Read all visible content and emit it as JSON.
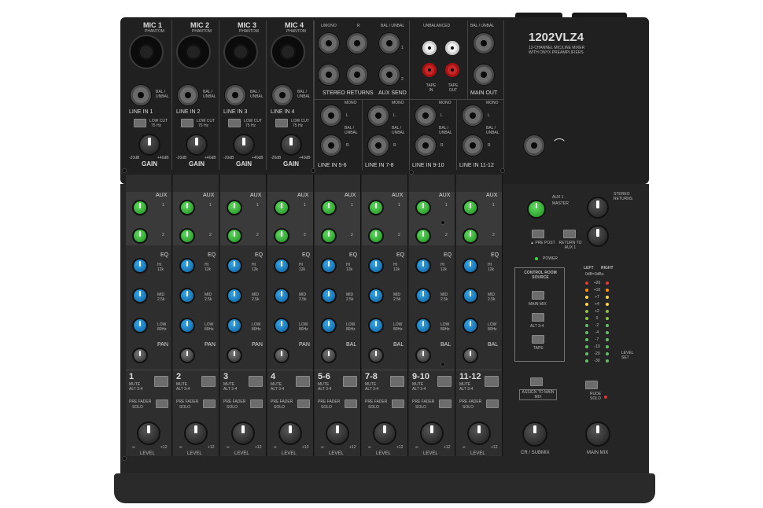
{
  "model": {
    "name": "1202VLZ4",
    "tagline_1": "12-CHANNEL MIC/LINE MIXER",
    "tagline_2": "WITH ONYX PREAMPLIFIERS"
  },
  "mic_channels": [
    {
      "mic_label": "MIC 1",
      "line_label": "LINE IN 1"
    },
    {
      "mic_label": "MIC 2",
      "line_label": "LINE IN 2"
    },
    {
      "mic_label": "MIC 3",
      "line_label": "LINE IN 3"
    },
    {
      "mic_label": "MIC 4",
      "line_label": "LINE IN 4"
    }
  ],
  "mic_small": "PHANTOM",
  "bal_unbal": "BAL / UNBAL",
  "low_cut": "LOW CUT",
  "low_cut_freq": "75 Hz",
  "gain": "GAIN",
  "gain_range": {
    "min": "-20dB",
    "max": "+40dB"
  },
  "top_right": {
    "l_mono": "L/MONO",
    "r": "R",
    "stereo_returns": "STEREO RETURNS",
    "bal_unbal": "BAL / UNBAL",
    "aux_send": "AUX SEND",
    "unbalanced": "UNBALANCED",
    "tape_in": "TAPE IN",
    "tape_out": "TAPE OUT",
    "main_out": "MAIN OUT",
    "mono": "MONO",
    "line_in_labels": [
      "LINE IN 5-6",
      "LINE IN 7-8",
      "LINE IN 9-10",
      "LINE IN 11-12"
    ],
    "num_1": "1",
    "num_2": "2",
    "l": "L"
  },
  "strip_labels": {
    "aux": "AUX",
    "aux_1": "1",
    "aux_2": "2",
    "eq": "EQ",
    "hi": "HI",
    "hi_freq": "12k",
    "mid": "MID",
    "mid_freq": "2.5k",
    "low": "LOW",
    "low_freq": "80Hz",
    "pan": "PAN",
    "bal": "BAL",
    "mute": "MUTE",
    "alt": "ALT 3-4",
    "pre_fader": "PRE FADER",
    "solo": "SOLO",
    "level": "LEVEL",
    "inf": "∞",
    "plus12": "+12"
  },
  "strips": [
    {
      "number": "1"
    },
    {
      "number": "2"
    },
    {
      "number": "3"
    },
    {
      "number": "4"
    },
    {
      "number": "5-6"
    },
    {
      "number": "7-8"
    },
    {
      "number": "9-10"
    },
    {
      "number": "11-12"
    }
  ],
  "master": {
    "aux1_master": "AUX 1",
    "master": "MASTER",
    "stereo_returns": "STEREO RETURNS",
    "pre_post": "▲ PRE POST",
    "return_to": "RETURN TO AUX 1",
    "power": "POWER",
    "control_room": "CONTROL ROOM SOURCE",
    "main_mix_btn": "MAIN MIX",
    "alt_btn": "ALT 3-4",
    "tape_btn": "TAPE",
    "assign": "ASSIGN TO MAIN MIX",
    "left": "LEFT",
    "right": "RIGHT",
    "dbu": "0dB=0dBu",
    "meter_marks": [
      "+20",
      "+10",
      "+7",
      "+4",
      "+2",
      "0",
      "-2",
      "-4",
      "-7",
      "-10",
      "-20",
      "-30"
    ],
    "level_set": "LEVEL SET",
    "rude_solo": "RUDE SOLO",
    "cr_submix": "CR / SUBMIX",
    "main_mix": "MAIN MIX"
  },
  "colors": {
    "aux_knob": "#2fa82f",
    "eq_knob": "#1a7cc0",
    "body": "#252525"
  }
}
